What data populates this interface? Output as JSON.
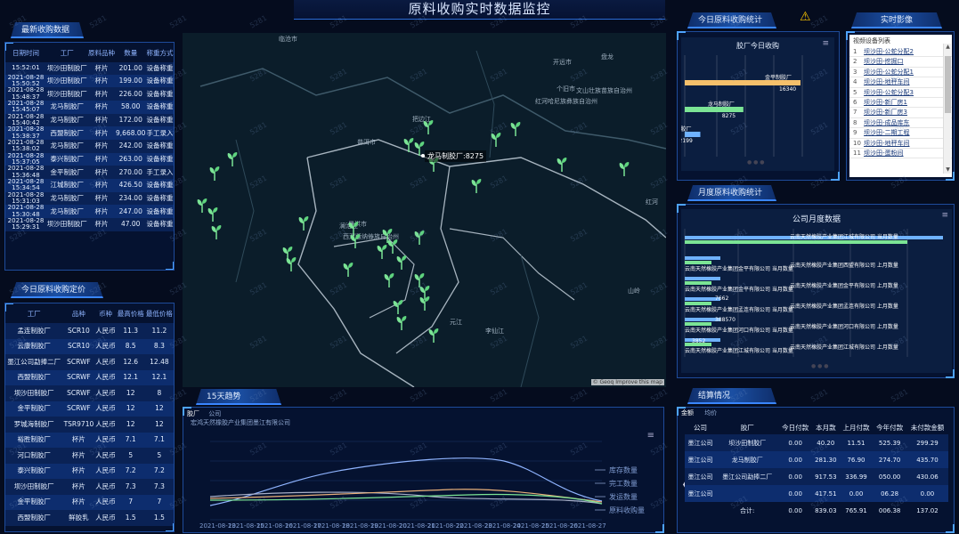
{
  "page": {
    "title": "原料收购实时数据监控"
  },
  "sections": {
    "latest": "最新收购数据",
    "today_price": "今日原料收购定价",
    "trend": "15天趋势",
    "today_stats": "今日原料收购统计",
    "live": "实时影像",
    "monthly": "月度原料收购统计",
    "settlement": "结算情况"
  },
  "latest_table": {
    "headers": [
      "日期时间",
      "工厂",
      "原料品种",
      "数量",
      "称重方式"
    ],
    "rows": [
      [
        "15:52:01",
        "坝沙田制胶厂",
        "杯片",
        "201.00",
        "设备称重"
      ],
      [
        "2021-08-28 15:50:52",
        "坝沙田制胶厂",
        "杯片",
        "199.00",
        "设备称重"
      ],
      [
        "2021-08-28 15:48:37",
        "坝沙田制胶厂",
        "杯片",
        "226.00",
        "设备称重"
      ],
      [
        "2021-08-28 15:45:07",
        "龙马制胶厂",
        "杯片",
        "58.00",
        "设备称重"
      ],
      [
        "2021-08-28 15:40:42",
        "龙马制胶厂",
        "杯片",
        "172.00",
        "设备称重"
      ],
      [
        "2021-08-28 15:38:37",
        "西盟制胶厂",
        "杯片",
        "9,668.00",
        "手工录入"
      ],
      [
        "2021-08-28 15:38:02",
        "龙马制胶厂",
        "杯片",
        "242.00",
        "设备称重"
      ],
      [
        "2021-08-28 15:37:05",
        "泰兴制胶厂",
        "杯片",
        "263.00",
        "设备称重"
      ],
      [
        "2021-08-28 15:36:48",
        "金平制胶厂",
        "杯片",
        "270.00",
        "手工录入"
      ],
      [
        "2021-08-28 15:34:54",
        "江城制胶厂",
        "杯片",
        "426.50",
        "设备称重"
      ],
      [
        "2021-08-28 15:31:03",
        "龙马制胶厂",
        "杯片",
        "234.00",
        "设备称重"
      ],
      [
        "2021-08-28 15:30:48",
        "龙马制胶厂",
        "杯片",
        "247.00",
        "设备称重"
      ],
      [
        "2021-08-28 15:29:31",
        "坝沙田制胶厂",
        "杯片",
        "47.00",
        "设备称重"
      ]
    ]
  },
  "price_table": {
    "headers": [
      "工厂",
      "品种",
      "币种",
      "最高价格",
      "最低价格"
    ],
    "rows": [
      [
        "孟连制胶厂",
        "SCR10",
        "人民币",
        "11.3",
        "11.2"
      ],
      [
        "云康制胶厂",
        "SCR10",
        "人民币",
        "8.5",
        "8.3"
      ],
      [
        "墨江公司勐捧二厂",
        "SCRWF",
        "人民币",
        "12.6",
        "12.48"
      ],
      [
        "西盟制胶厂",
        "SCRWF",
        "人民币",
        "12.1",
        "12.1"
      ],
      [
        "坝沙田制胶厂",
        "SCRWF",
        "人民币",
        "12",
        "8"
      ],
      [
        "金平制胶厂",
        "SCRWF",
        "人民币",
        "12",
        "12"
      ],
      [
        "罗城海制胶厂",
        "TSR9710",
        "人民币",
        "12",
        "12"
      ],
      [
        "裕胜制胶厂",
        "杯片",
        "人民币",
        "7.1",
        "7.1"
      ],
      [
        "河口制胶厂",
        "杯片",
        "人民币",
        "5",
        "5"
      ],
      [
        "泰兴制胶厂",
        "杯片",
        "人民币",
        "7.2",
        "7.2"
      ],
      [
        "坝沙田制胶厂",
        "杯片",
        "人民币",
        "7.3",
        "7.3"
      ],
      [
        "金平制胶厂",
        "杯片",
        "人民币",
        "7",
        "7"
      ],
      [
        "西盟制胶厂",
        "鲜胶乳",
        "人民币",
        "1.5",
        "1.5"
      ]
    ]
  },
  "map": {
    "tooltip": "龙马制胶厂:8275",
    "attribution": "© Geoq Improve this map",
    "places": [
      "临沧市",
      "普洱市",
      "红河哈尼族彝族自治州",
      "文山壮族苗族自治州",
      "景洪市",
      "西双版纳傣族自治州",
      "把边江",
      "开远市",
      "个旧市",
      "澜沧江",
      "李仙江",
      "元江",
      "盘龙",
      "红河",
      "山岭"
    ]
  },
  "trend": {
    "tabs": [
      "胶厂",
      "公司"
    ],
    "subtitle": "宏鸿天然橡胶产业集团墨江有限公司",
    "legend": [
      "库存数量",
      "完工数量",
      "发运数量",
      "原料收购量"
    ],
    "dates": [
      "2021-08-13",
      "2021-08-15",
      "2021-08-16",
      "2021-08-17",
      "2021-08-18",
      "2021-08-19",
      "2021-08-20",
      "2021-08-21",
      "2021-08-22",
      "2021-08-23",
      "2021-08-24",
      "2021-08-25",
      "2021-08-26",
      "2021-08-27"
    ]
  },
  "today_stats": {
    "chart_title": "胶厂今日收购",
    "bars": [
      {
        "label": "金平制胶厂",
        "value": "16340"
      },
      {
        "label": "龙马制胶厂",
        "value": "8275"
      },
      {
        "label": "江城制胶厂",
        "value": "2199"
      }
    ]
  },
  "live": {
    "list_title": "视频设备列表",
    "items": [
      "坝沙田-公蛇分配2",
      "坝沙田-挖掘口",
      "坝沙田-公蛇分配1",
      "坝沙田-地秤车间",
      "坝沙田-公蛇分配3",
      "坝沙田-新厂房1",
      "坝沙田-新厂房3",
      "坝沙田-成品库东",
      "坝沙田-二期工程",
      "坝沙田-地秤车间",
      "坝沙田-蛋粉间"
    ]
  },
  "monthly": {
    "chart_title": "公司月度数据",
    "rows": [
      {
        "left": "",
        "right": "云南天然橡胶产业集团江城有限公司 当月数量"
      },
      {
        "left": "云南天然橡胶产业集团金平有限公司 当月数量",
        "right": "云南天然橡胶产业集团西盟有限公司 上月数量"
      },
      {
        "left": "云南天然橡胶产业集团金平有限公司 当月数量",
        "right": "云南天然橡胶产业集团金平有限公司 上月数量"
      },
      {
        "left": "云南天然橡胶产业集团孟连有限公司 当月数量",
        "right": "云南天然橡胶产业集团孟连有限公司 上月数量"
      },
      {
        "left": "云南天然橡胶产业集团河口有限公司 当月数量",
        "right": "云南天然橡胶产业集团河口有限公司 上月数量"
      },
      {
        "left": "云南天然橡胶产业集团江城有限公司 当月数量",
        "right": "云南天然橡胶产业集团江城有限公司 上月数量"
      }
    ],
    "values": [
      "7662",
      "388570",
      "3852"
    ]
  },
  "settlement": {
    "tabs": [
      "金额",
      "均价"
    ],
    "headers": [
      "公司",
      "胶厂",
      "今日付款",
      "本月款",
      "上月付款",
      "今年付款",
      "未付款金额"
    ],
    "rows": [
      [
        "墨江公司",
        "坝沙田制胶厂",
        "0.00",
        "40.20",
        "11.51",
        "525.39",
        "299.29"
      ],
      [
        "墨江公司",
        "龙马制胶厂",
        "0.00",
        "281.30",
        "76.90",
        "274.70",
        "435.70"
      ],
      [
        "墨江公司",
        "墨江公司勐捧二厂",
        "0.00",
        "917.53",
        "336.99",
        "050.00",
        "430.06"
      ],
      [
        "墨江公司",
        "",
        "0.00",
        "417.51",
        "0.00",
        "06.28",
        "0.00"
      ]
    ],
    "total_label": "合计:",
    "total": [
      "0.00",
      "839.03",
      "765.91",
      "006.38",
      "137.02"
    ]
  },
  "colors": {
    "bg": "#050c1e",
    "panel": "#061434",
    "accent": "#3a86ff",
    "orange": "#f5c06b",
    "green": "#7be495",
    "blue": "#6fb2ff",
    "sprout": "#7be495"
  }
}
